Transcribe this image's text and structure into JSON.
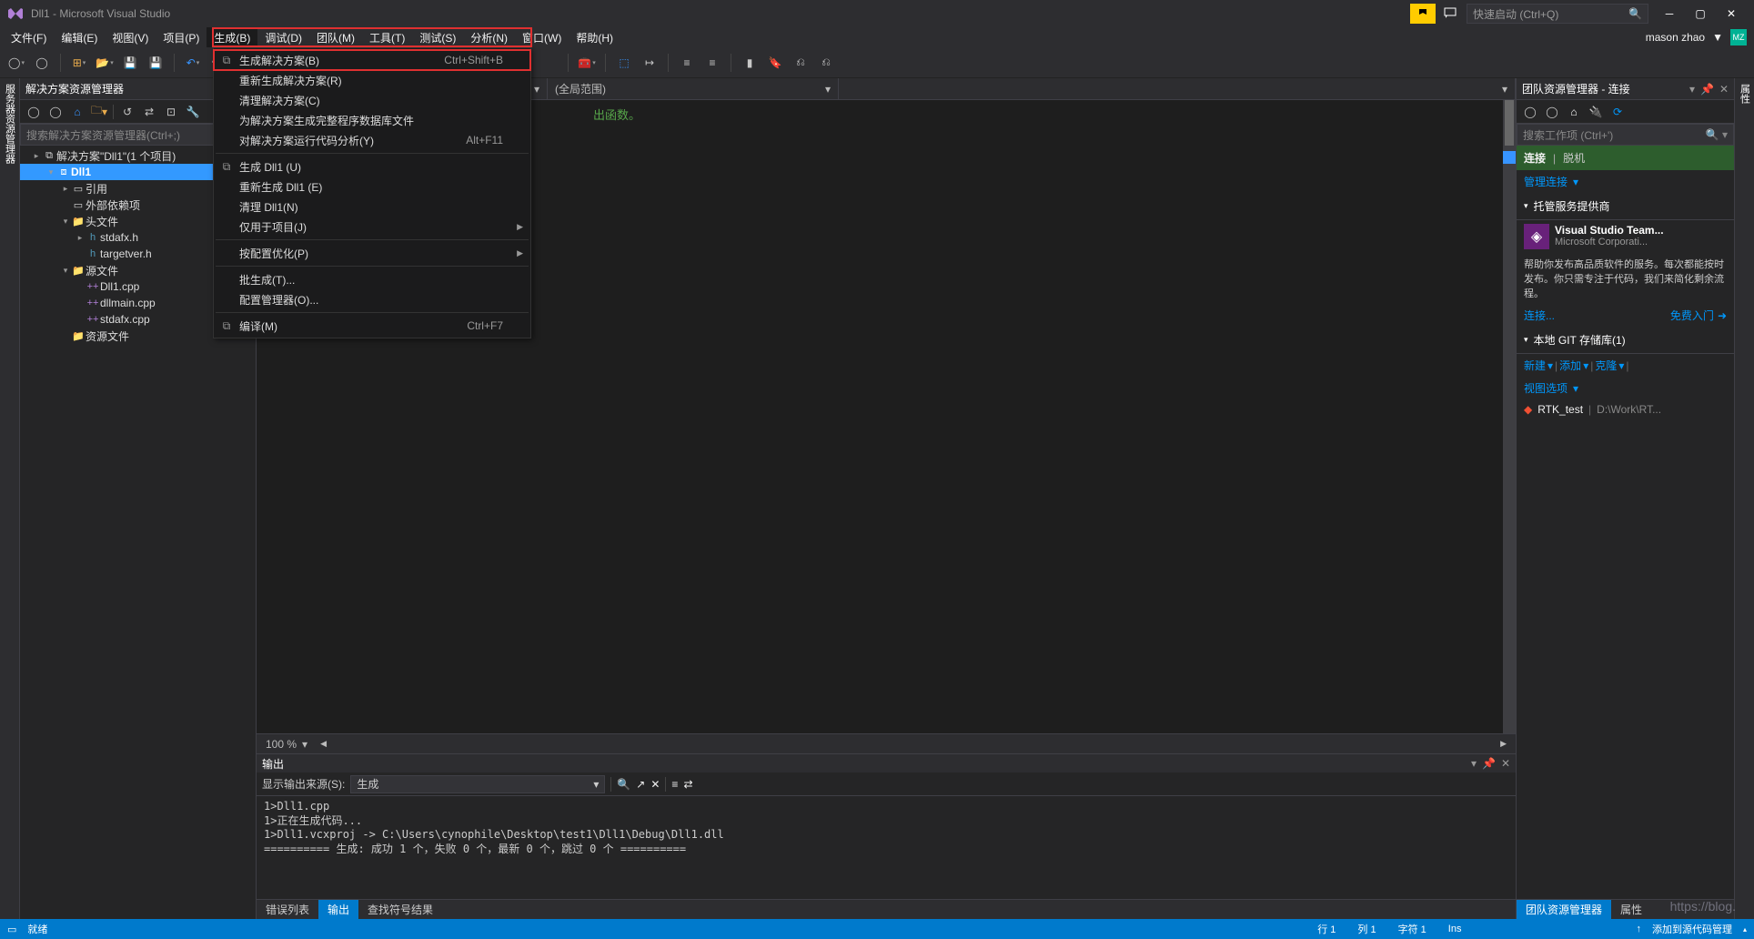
{
  "titlebar": {
    "title": "Dll1 - Microsoft Visual Studio",
    "quicklaunch_placeholder": "快速启动 (Ctrl+Q)"
  },
  "menubar": {
    "items": [
      "文件(F)",
      "编辑(E)",
      "视图(V)",
      "项目(P)",
      "生成(B)",
      "调试(D)",
      "团队(M)",
      "工具(T)",
      "测试(S)",
      "分析(N)",
      "窗口(W)",
      "帮助(H)"
    ],
    "username": "mason zhao",
    "avatar": "MZ"
  },
  "build_menu": {
    "items": [
      {
        "label": "生成解决方案(B)",
        "shortcut": "Ctrl+Shift+B",
        "icon": "build",
        "highlight": true
      },
      {
        "label": "重新生成解决方案(R)"
      },
      {
        "label": "清理解决方案(C)"
      },
      {
        "label": "为解决方案生成完整程序数据库文件"
      },
      {
        "label": "对解决方案运行代码分析(Y)",
        "shortcut": "Alt+F11"
      },
      {
        "sep": true
      },
      {
        "label": "生成 Dll1 (U)",
        "icon": "build"
      },
      {
        "label": "重新生成 Dll1 (E)"
      },
      {
        "label": "清理 Dll1(N)"
      },
      {
        "label": "仅用于项目(J)",
        "submenu": true
      },
      {
        "sep": true
      },
      {
        "label": "按配置优化(P)",
        "submenu": true
      },
      {
        "sep": true
      },
      {
        "label": "批生成(T)..."
      },
      {
        "label": "配置管理器(O)..."
      },
      {
        "sep": true
      },
      {
        "label": "编译(M)",
        "shortcut": "Ctrl+F7",
        "icon": "compile"
      }
    ]
  },
  "leftstrip": {
    "label": "服务器资源管理器"
  },
  "rightstrip": {
    "label": "属性"
  },
  "solution_explorer": {
    "title": "解决方案资源管理器",
    "search_placeholder": "搜索解决方案资源管理器(Ctrl+;)",
    "tree": [
      {
        "d": 1,
        "arrow": "▸",
        "icon": "⧉",
        "label": "解决方案\"Dll1\"(1 个项目)"
      },
      {
        "d": 2,
        "arrow": "▾",
        "icon": "⧈",
        "label": "Dll1",
        "bold": true,
        "selected": true
      },
      {
        "d": 3,
        "arrow": "▸",
        "icon": "▭",
        "label": "引用"
      },
      {
        "d": 3,
        "arrow": "",
        "icon": "▭",
        "label": "外部依赖项"
      },
      {
        "d": 3,
        "arrow": "▾",
        "icon": "📁",
        "label": "头文件"
      },
      {
        "d": 4,
        "arrow": "▸",
        "icon": "h",
        "label": "stdafx.h"
      },
      {
        "d": 4,
        "arrow": "",
        "icon": "h",
        "label": "targetver.h"
      },
      {
        "d": 3,
        "arrow": "▾",
        "icon": "📁",
        "label": "源文件"
      },
      {
        "d": 4,
        "arrow": "",
        "icon": "++",
        "label": "Dll1.cpp"
      },
      {
        "d": 4,
        "arrow": "",
        "icon": "++",
        "label": "dllmain.cpp"
      },
      {
        "d": 4,
        "arrow": "",
        "icon": "++",
        "label": "stdafx.cpp"
      },
      {
        "d": 3,
        "arrow": "",
        "icon": "📁",
        "label": "资源文件"
      }
    ]
  },
  "editor": {
    "nav_scope": "(全局范围)",
    "code_hint": "出函数。",
    "zoom": "100 %"
  },
  "output_panel": {
    "title": "输出",
    "source_label": "显示输出来源(S):",
    "source_value": "生成",
    "lines": "1>Dll1.cpp\n1>正在生成代码...\n1>Dll1.vcxproj -> C:\\Users\\cynophile\\Desktop\\test1\\Dll1\\Debug\\Dll1.dll\n========== 生成: 成功 1 个，失败 0 个，最新 0 个，跳过 0 个 =========="
  },
  "bottom_tabs": {
    "left": [
      "错误列表",
      "输出",
      "查找符号结果"
    ],
    "right": [
      "团队资源管理器",
      "属性"
    ]
  },
  "team_explorer": {
    "title": "团队资源管理器 - 连接",
    "search_placeholder": "搜索工作项 (Ctrl+')",
    "section_connect": "连接",
    "offline": "脱机",
    "manage_link": "管理连接",
    "hosted_title": "托管服务提供商",
    "vsts_title": "Visual Studio Team...",
    "vsts_sub": "Microsoft Corporati...",
    "vsts_desc": "帮助你发布高品质软件的服务。每次都能按时发布。你只需专注于代码，我们来简化剩余流程。",
    "connect_link": "连接...",
    "free_link": "免费入门",
    "git_title": "本地 GIT 存储库(1)",
    "git_actions": [
      "新建",
      "添加",
      "克隆"
    ],
    "git_view": "视图选项",
    "repo_name": "RTK_test",
    "repo_path": "D:\\Work\\RT..."
  },
  "statusbar": {
    "ready": "就绪",
    "line": "行 1",
    "col": "列 1",
    "char": "字符 1",
    "ins": "Ins",
    "source_control": "添加到源代码管理"
  },
  "watermark": "https://blog."
}
